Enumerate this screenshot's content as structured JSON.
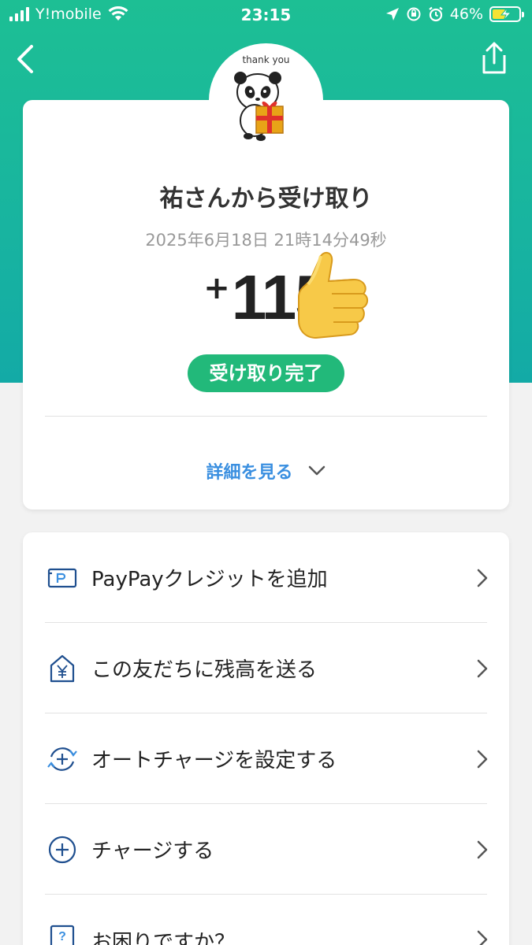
{
  "status_bar": {
    "carrier": "Y!mobile",
    "time": "23:15",
    "battery_percent": "46%"
  },
  "nav": {
    "back_icon": "chevron-left-icon",
    "share_icon": "share-icon"
  },
  "avatar": {
    "caption": "thank you"
  },
  "transaction": {
    "title": "祐さんから受け取り",
    "timestamp": "2025年6月18日 21時14分49秒",
    "amount_sign": "+",
    "amount": "115",
    "status": "受け取り完了",
    "details_label": "詳細を見る"
  },
  "menu": {
    "items": [
      {
        "label": "PayPayクレジットを追加",
        "icon": "credit-card-icon"
      },
      {
        "label": "この友だちに残高を送る",
        "icon": "send-balance-icon"
      },
      {
        "label": "オートチャージを設定する",
        "icon": "auto-charge-icon"
      },
      {
        "label": "チャージする",
        "icon": "plus-circle-icon"
      },
      {
        "label": "お困りですか？",
        "icon": "help-icon"
      }
    ]
  },
  "colors": {
    "brand_green": "#1dbf94",
    "status_green": "#22b97a",
    "link_blue": "#3a8fe0",
    "icon_navy": "#1f4f8f"
  }
}
